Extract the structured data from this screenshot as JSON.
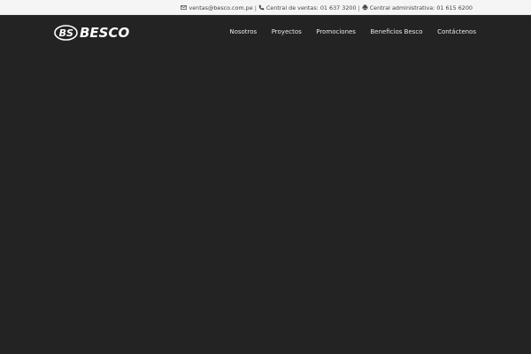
{
  "topbar": {
    "email": "ventas@besco.com.pe",
    "sales_phone": "Central de ventas: 01 637 3200",
    "admin_phone": "Central administrativa: 01 615 6200",
    "separator": "|",
    "icons": [
      "envelope-icon",
      "phone-icon",
      "fax-icon"
    ]
  },
  "brand": {
    "mark": "BS",
    "name": "BESCO"
  },
  "nav": {
    "items": [
      "Nosotros",
      "Proyectos",
      "Promociones",
      "Beneficios Besco",
      "Contáctenos"
    ]
  },
  "colors": {
    "background": "#232323",
    "topbar": "#f5f5f5",
    "nav_text": "#e8e8e8"
  }
}
